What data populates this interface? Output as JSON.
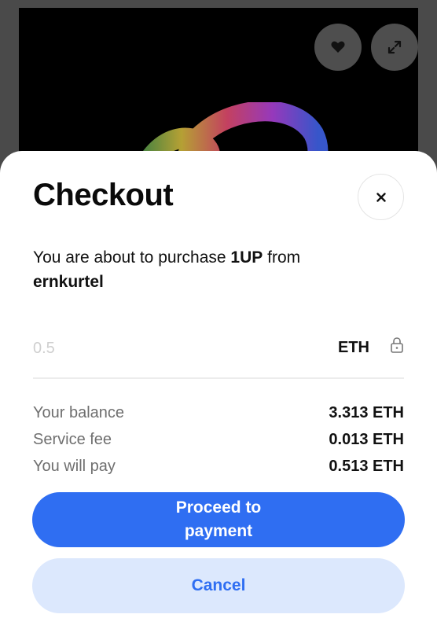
{
  "background": {
    "favorite_icon": "heart-icon",
    "expand_icon": "expand-icon"
  },
  "checkout": {
    "title": "Checkout",
    "close_icon": "close-icon",
    "description_prefix": "You are about to purchase ",
    "item_name": "1UP",
    "description_middle": " from",
    "seller": "ernkurtel",
    "amount_placeholder": "0.5",
    "amount_value": "",
    "currency": "ETH",
    "lock_icon": "lock-icon",
    "summary": [
      {
        "label": "Your balance",
        "value": "3.313 ETH"
      },
      {
        "label": "Service fee",
        "value": "0.013 ETH"
      },
      {
        "label": "You will pay",
        "value": "0.513 ETH"
      }
    ],
    "primary_button": "Proceed to payment",
    "secondary_button": "Cancel"
  },
  "colors": {
    "accent": "#2f6ef2",
    "accent_light": "#dce8fd",
    "muted_text": "#6f6f6f"
  }
}
